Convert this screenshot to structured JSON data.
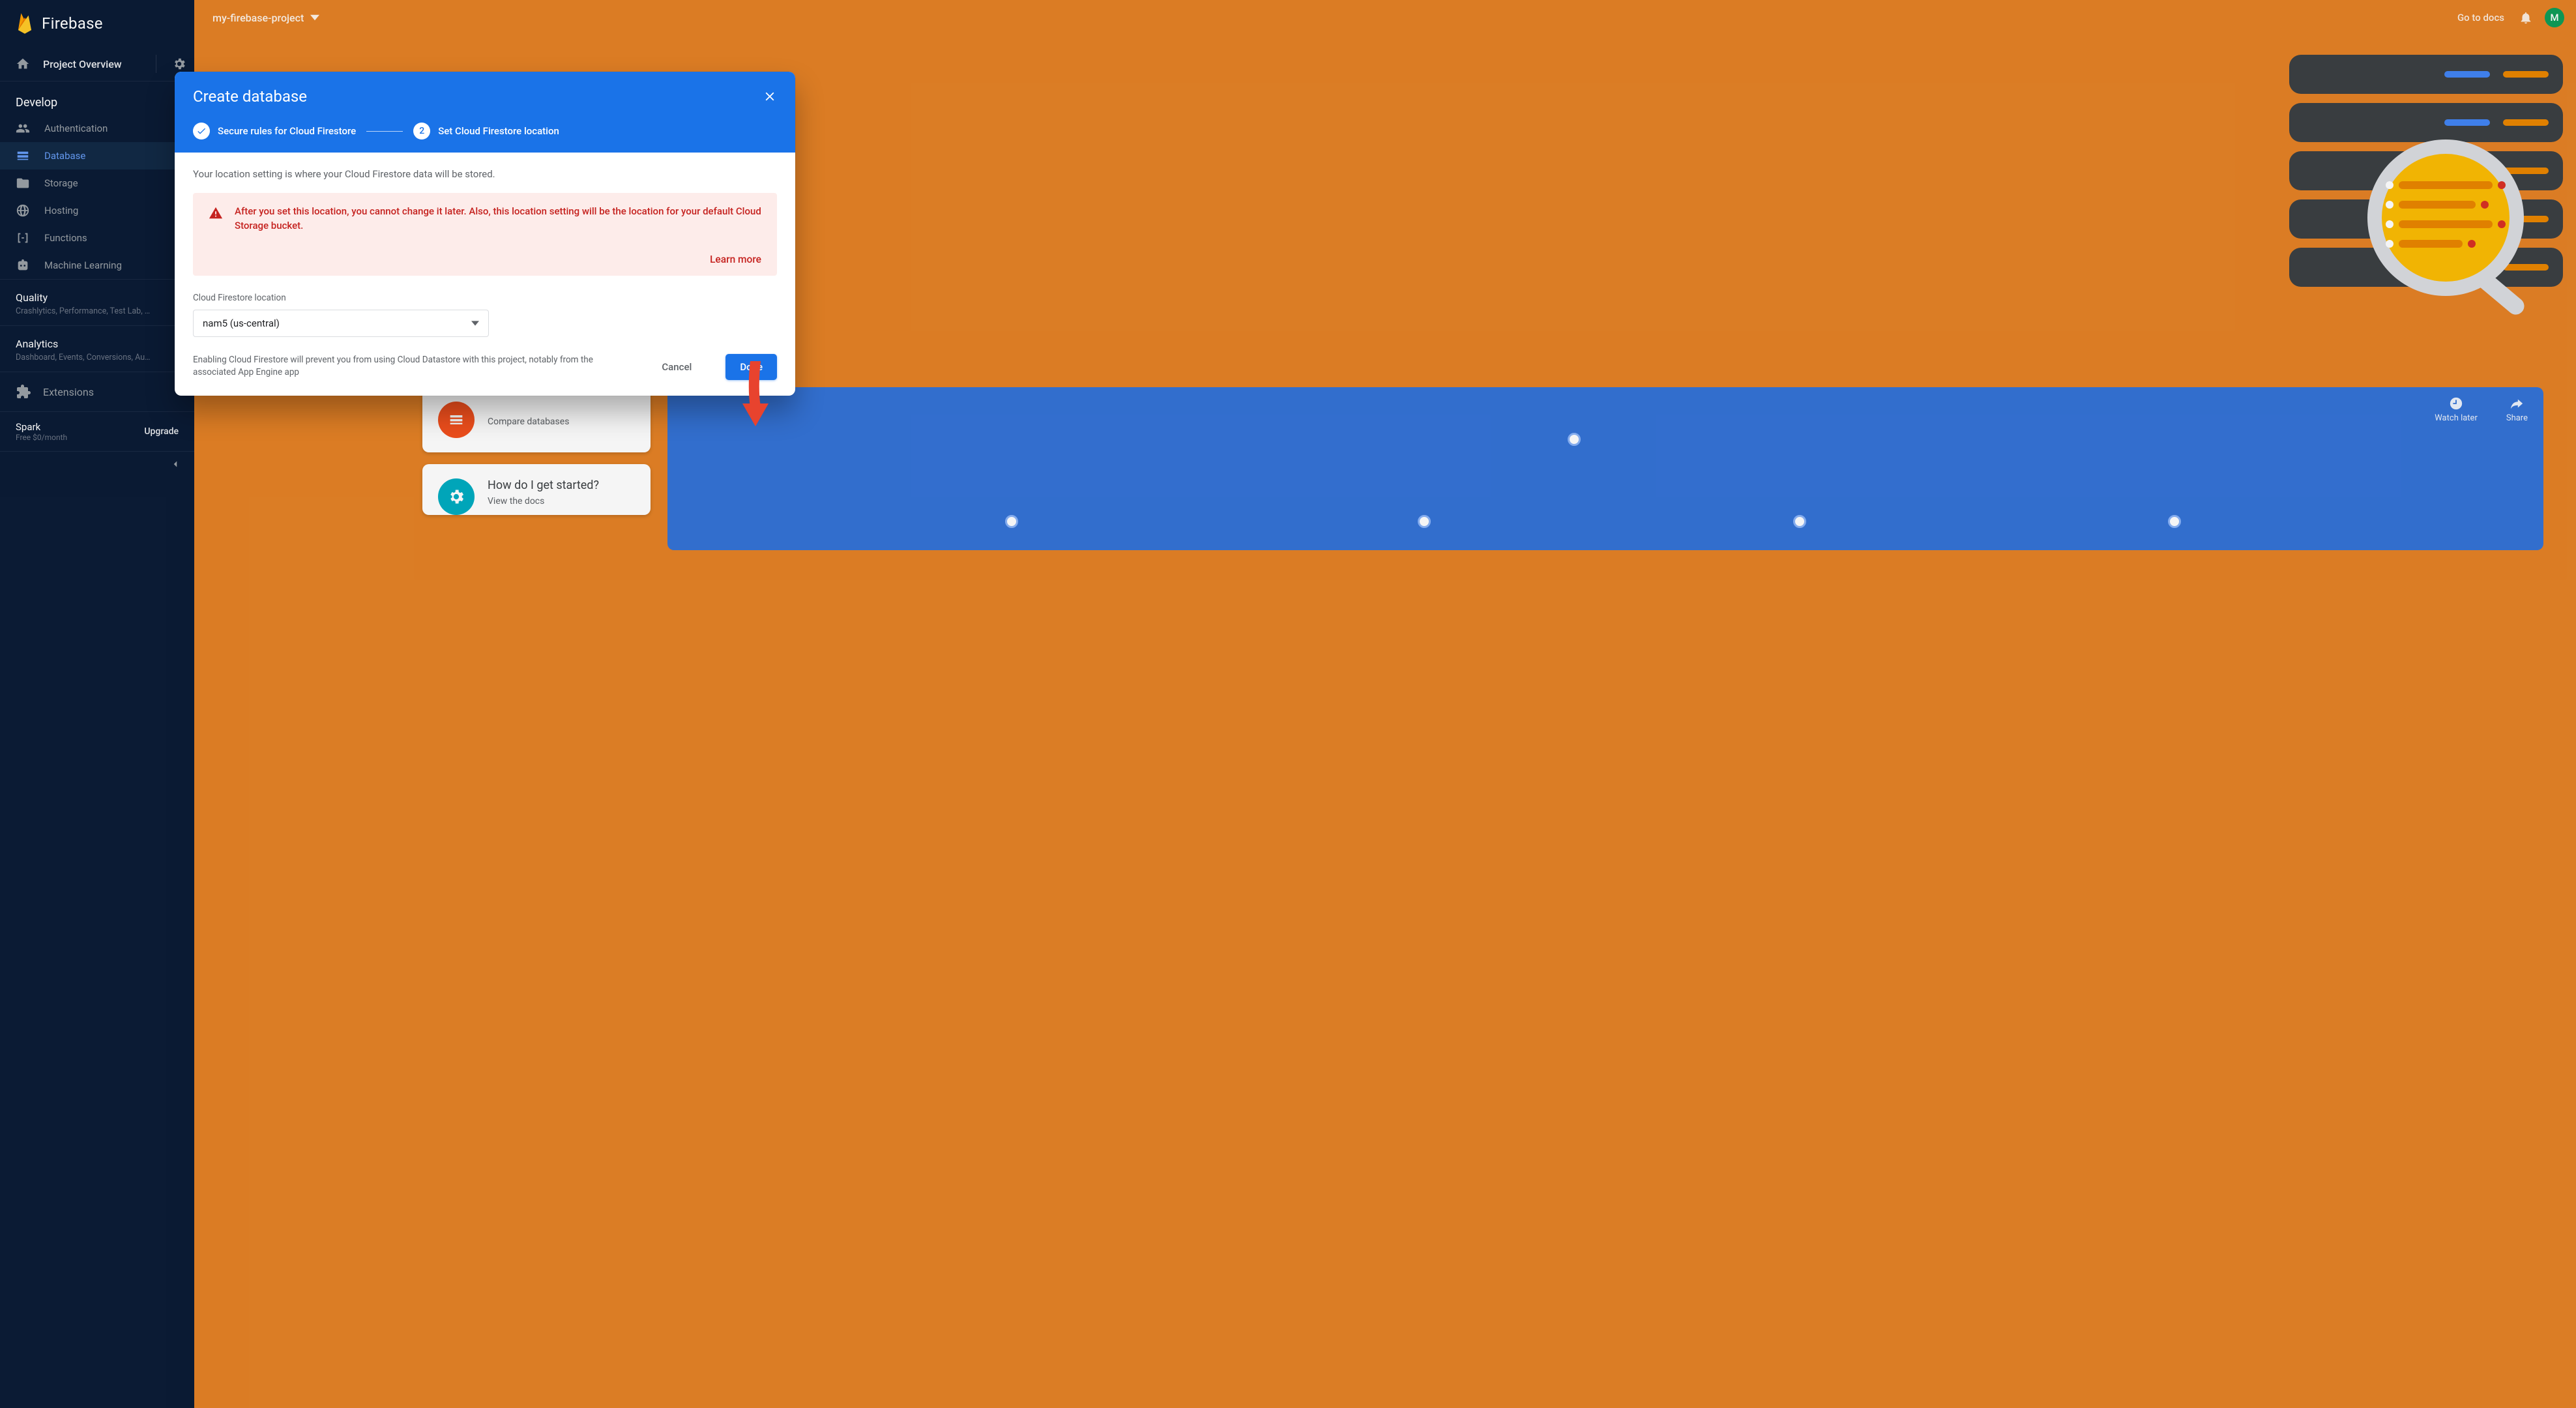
{
  "brand": {
    "name": "Firebase"
  },
  "topbar": {
    "project_name": "my-firebase-project",
    "docs_label": "Go to docs",
    "avatar_initial": "M"
  },
  "sidebar": {
    "overview_label": "Project Overview",
    "develop_header": "Develop",
    "items": [
      {
        "id": "auth",
        "label": "Authentication"
      },
      {
        "id": "db",
        "label": "Database"
      },
      {
        "id": "storage",
        "label": "Storage"
      },
      {
        "id": "hosting",
        "label": "Hosting"
      },
      {
        "id": "func",
        "label": "Functions"
      },
      {
        "id": "ml",
        "label": "Machine Learning"
      }
    ],
    "quality": {
      "title": "Quality",
      "sub": "Crashlytics, Performance, Test Lab, …"
    },
    "analytics": {
      "title": "Analytics",
      "sub": "Dashboard, Events, Conversions, Au…"
    },
    "extensions_label": "Extensions",
    "plan": {
      "name": "Spark",
      "price": "Free $0/month",
      "upgrade": "Upgrade"
    }
  },
  "dialog": {
    "title": "Create database",
    "step1": "Secure rules for Cloud Firestore",
    "step2_num": "2",
    "step2": "Set Cloud Firestore location",
    "intro": "Your location setting is where your Cloud Firestore data will be stored.",
    "warning": "After you set this location, you cannot change it later. Also, this location setting will be the location for your default Cloud Storage bucket.",
    "learn_more": "Learn more",
    "field_label": "Cloud Firestore location",
    "selected_location": "nam5 (us-central)",
    "footer_note": "Enabling Cloud Firestore will prevent you from using Cloud Datastore with this project, notably from the associated App Engine app",
    "cancel": "Cancel",
    "done": "Done"
  },
  "bg": {
    "card1_sub": "Compare databases",
    "card2_title": "How do I get started?",
    "card2_sub": "View the docs",
    "video_watch": "Watch later",
    "video_share": "Share"
  }
}
